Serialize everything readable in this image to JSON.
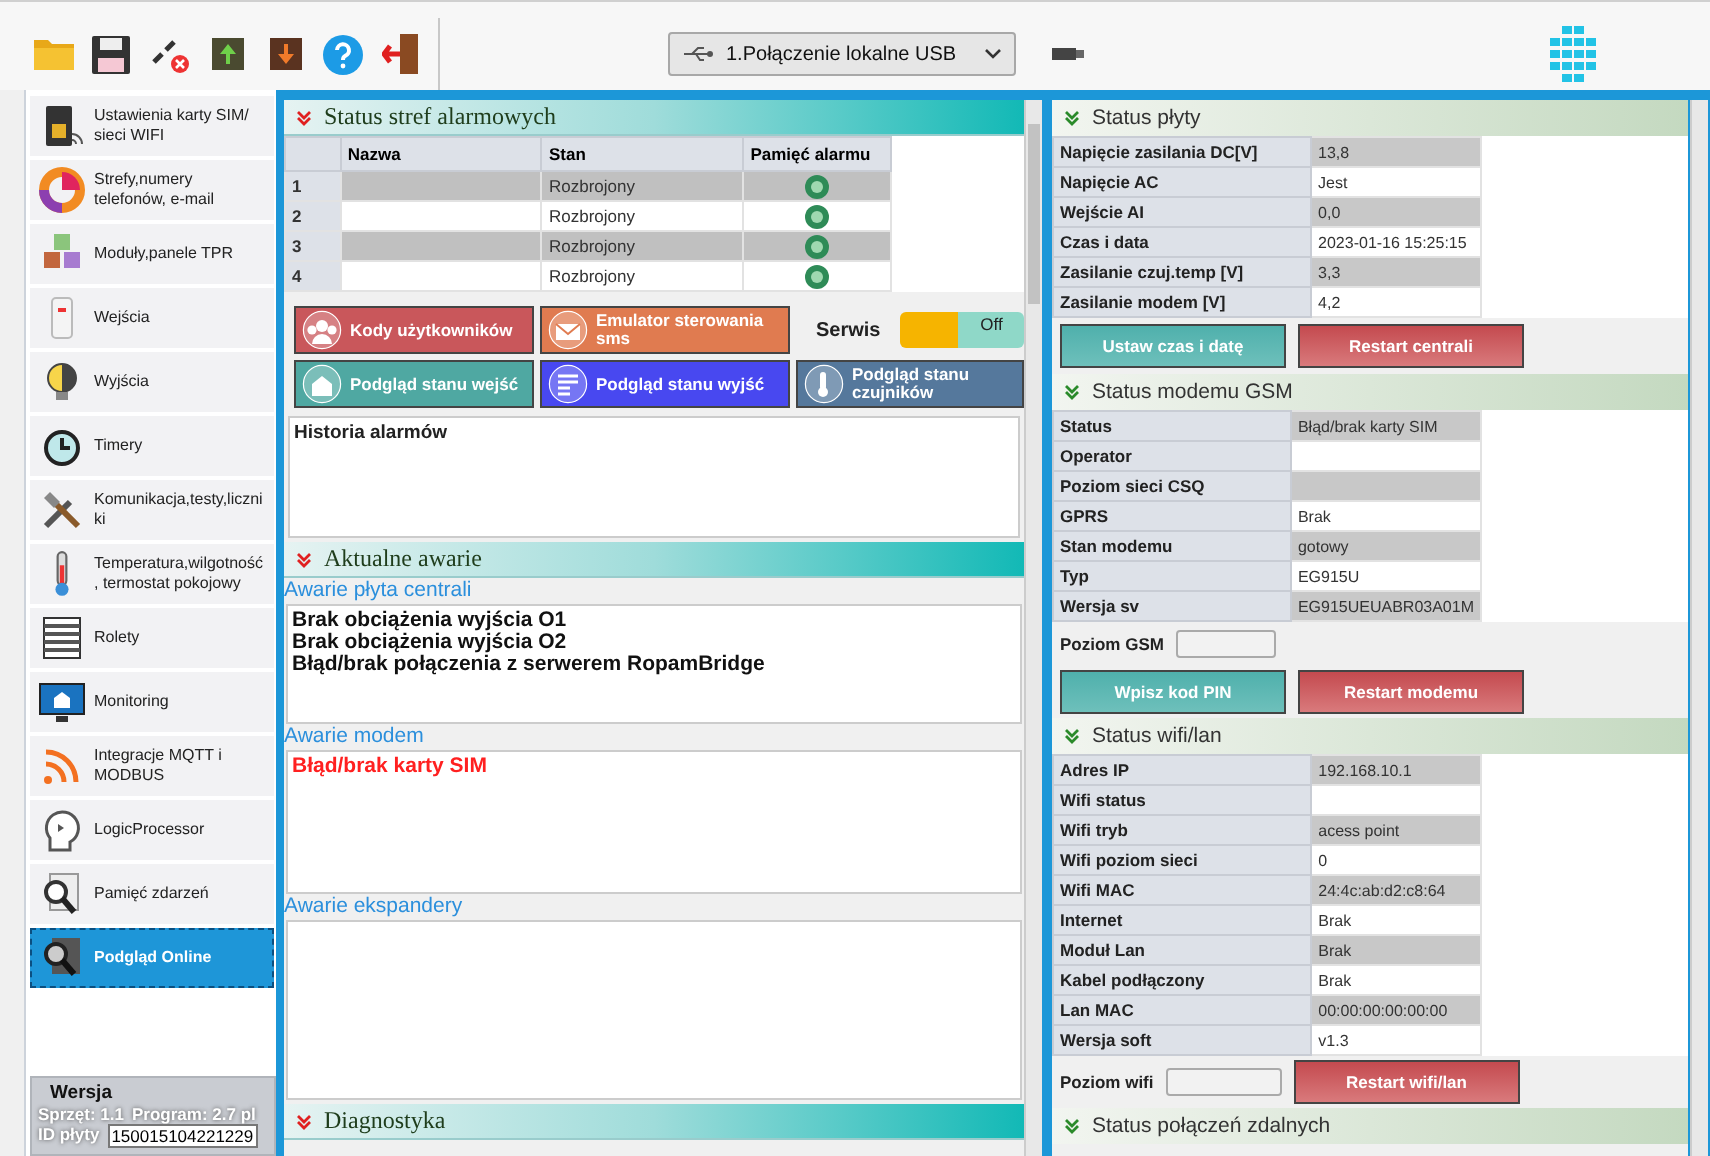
{
  "toolbar": {
    "connection": "1.Połączenie lokalne USB"
  },
  "sidebar": {
    "items": [
      {
        "label": "Ustawienia karty SIM/ sieci WIFI",
        "selected": false
      },
      {
        "label": "Strefy,numery telefonów, e-mail",
        "selected": false
      },
      {
        "label": "Moduły,panele TPR",
        "selected": false
      },
      {
        "label": "Wejścia",
        "selected": false
      },
      {
        "label": "Wyjścia",
        "selected": false
      },
      {
        "label": "Timery",
        "selected": false
      },
      {
        "label": "Komunikacja,testy,liczniki",
        "selected": false
      },
      {
        "label": "Temperatura,wilgotność, termostat pokojowy",
        "selected": false
      },
      {
        "label": "Rolety",
        "selected": false
      },
      {
        "label": "Monitoring",
        "selected": false
      },
      {
        "label": "Integracje MQTT i MODBUS",
        "selected": false
      },
      {
        "label": "LogicProcessor",
        "selected": false
      },
      {
        "label": "Pamięć zdarzeń",
        "selected": false
      },
      {
        "label": "Podgląd Online",
        "selected": true
      }
    ],
    "version": {
      "title": "Wersja",
      "hardware": "Sprzęt: 1.1",
      "program": "Program: 2.7 pl",
      "board_id_label": "ID płyty",
      "board_id": "150015104221229"
    }
  },
  "zones": {
    "title": "Status stref alarmowych",
    "columns": [
      "Nazwa",
      "Stan",
      "Pamięć alarmu"
    ],
    "rows": [
      {
        "number": "1",
        "state": "Rozbrojony",
        "alarm_memory": false
      },
      {
        "number": "2",
        "state": "Rozbrojony",
        "alarm_memory": false
      },
      {
        "number": "3",
        "state": "Rozbrojony",
        "alarm_memory": false
      },
      {
        "number": "4",
        "state": "Rozbrojony",
        "alarm_memory": false
      }
    ]
  },
  "action_buttons": [
    {
      "label": "Kody użytkowników",
      "color": "#c9575b"
    },
    {
      "label": "Emulator sterowania sms",
      "color": "#e07b50"
    },
    {
      "label": "Podgląd stanu wejść",
      "color": "#4fa8a2"
    },
    {
      "label": "Podgląd stanu wyjść",
      "color": "#4848f0"
    },
    {
      "label": "Podgląd stanu czujników",
      "color": "#55789c"
    }
  ],
  "service": {
    "label": "Serwis",
    "on": false,
    "state_label": "Off"
  },
  "history": {
    "title": "Historia alarmów"
  },
  "faults": {
    "title": "Aktualne awarie",
    "groups": [
      {
        "title": "Awarie płyta centrali",
        "items": [
          {
            "text": "Brak obciążenia wyjścia O1",
            "kind": "normal"
          },
          {
            "text": "Brak obciążenia wyjścia O2",
            "kind": "normal"
          },
          {
            "text": "Błąd/brak połączenia z serwerem RopamBridge",
            "kind": "normal"
          }
        ]
      },
      {
        "title": "Awarie modem",
        "items": [
          {
            "text": "Błąd/brak karty SIM",
            "kind": "error"
          }
        ]
      },
      {
        "title": "Awarie ekspandery"
      }
    ]
  },
  "diagnostics": {
    "title": "Diagnostyka"
  },
  "board_status": {
    "title": "Status płyty",
    "rows": [
      {
        "label": "Napięcie zasilania DC[V]",
        "value": "13,8"
      },
      {
        "label": "Napięcie AC",
        "value": "Jest"
      },
      {
        "label": "Wejście AI",
        "value": "0,0"
      },
      {
        "label": "Czas i data",
        "value": "2023-01-16 15:25:15"
      },
      {
        "label": "Zasilanie czuj.temp [V]",
        "value": "3,3"
      },
      {
        "label": "Zasilanie modem [V]",
        "value": "4,2"
      }
    ],
    "buttons": [
      {
        "label": "Ustaw czas i datę",
        "kind": "teal"
      },
      {
        "label": "Restart centrali",
        "kind": "red"
      }
    ]
  },
  "gsm_status": {
    "title": "Status modemu GSM",
    "rows": [
      {
        "label": "Status",
        "value": "Błąd/brak karty SIM"
      },
      {
        "label": "Operator"
      },
      {
        "label": "Poziom sieci CSQ"
      },
      {
        "label": "GPRS",
        "value": "Brak"
      },
      {
        "label": "Stan modemu",
        "value": "gotowy"
      },
      {
        "label": "Typ",
        "value": "EG915U"
      },
      {
        "label": "Wersja sv",
        "value": "EG915UEUABR03A01M"
      }
    ],
    "level_label": "Poziom GSM",
    "buttons": [
      {
        "label": "Wpisz kod PIN",
        "kind": "teal"
      },
      {
        "label": "Restart modemu",
        "kind": "red"
      }
    ]
  },
  "wifi_status": {
    "title": "Status wifi/lan",
    "rows": [
      {
        "label": "Adres IP",
        "value": "192.168.10.1"
      },
      {
        "label": "Wifi status"
      },
      {
        "label": "Wifi tryb",
        "value": "acess point"
      },
      {
        "label": "Wifi poziom sieci",
        "value": "0"
      },
      {
        "label": "Wifi MAC",
        "value": "24:4c:ab:d2:c8:64"
      },
      {
        "label": "Internet",
        "value": "Brak"
      },
      {
        "label": "Moduł Lan",
        "value": "Brak"
      },
      {
        "label": "Kabel podłączony",
        "value": "Brak"
      },
      {
        "label": "Lan MAC",
        "value": "00:00:00:00:00:00"
      },
      {
        "label": "Wersja soft",
        "value": "v1.3"
      }
    ],
    "level_label": "Poziom wifi",
    "buttons": [
      {
        "label": "Restart wifi/lan",
        "kind": "red"
      }
    ]
  },
  "remote_status": {
    "title": "Status połączeń zdalnych"
  }
}
